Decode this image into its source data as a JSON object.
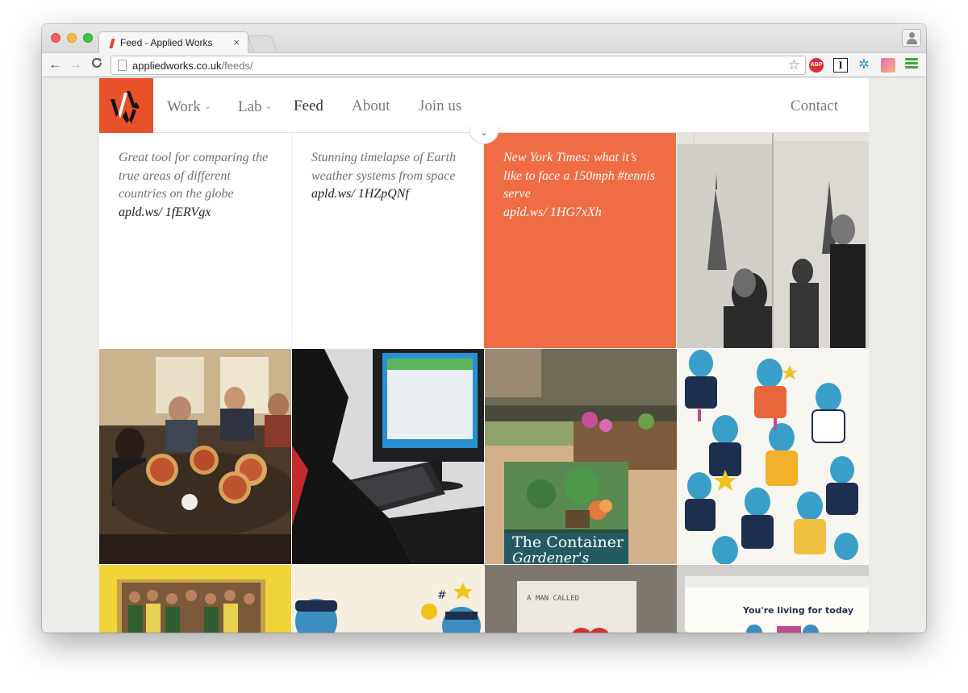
{
  "browser": {
    "tab_title": "Feed - Applied Works",
    "tab_close": "×",
    "url_host": "appliedworks.co.uk",
    "url_path": "/feeds/",
    "back": "←",
    "forward": "→",
    "reload": "C",
    "star": "☆",
    "ext_abp": "ABP",
    "ext_i": "I"
  },
  "site": {
    "brand_color": "#e9502c",
    "nav": {
      "work": "Work",
      "lab": "Lab",
      "feed": "Feed",
      "about": "About",
      "join": "Join us",
      "contact": "Contact"
    },
    "chevron": "⌄"
  },
  "feed": {
    "text_posts": [
      {
        "text": "Great tool for comparing the true areas of different countries on the globe",
        "link": "apld.ws/ 1fERVgx"
      },
      {
        "text": "Stunning timelapse of Earth weather systems from space",
        "link": "apld.ws/ 1HZpQNf"
      },
      {
        "text": "New York Times: what it’s like to face a 150mph #tennis serve",
        "link": "apld.ws/ 1HG7xXh"
      }
    ],
    "image_labels": {
      "book_title": "The Container",
      "book_subtitle": "Gardener's",
      "novel_title": "A MAN CALLED",
      "app_text": "You're living for today"
    }
  }
}
